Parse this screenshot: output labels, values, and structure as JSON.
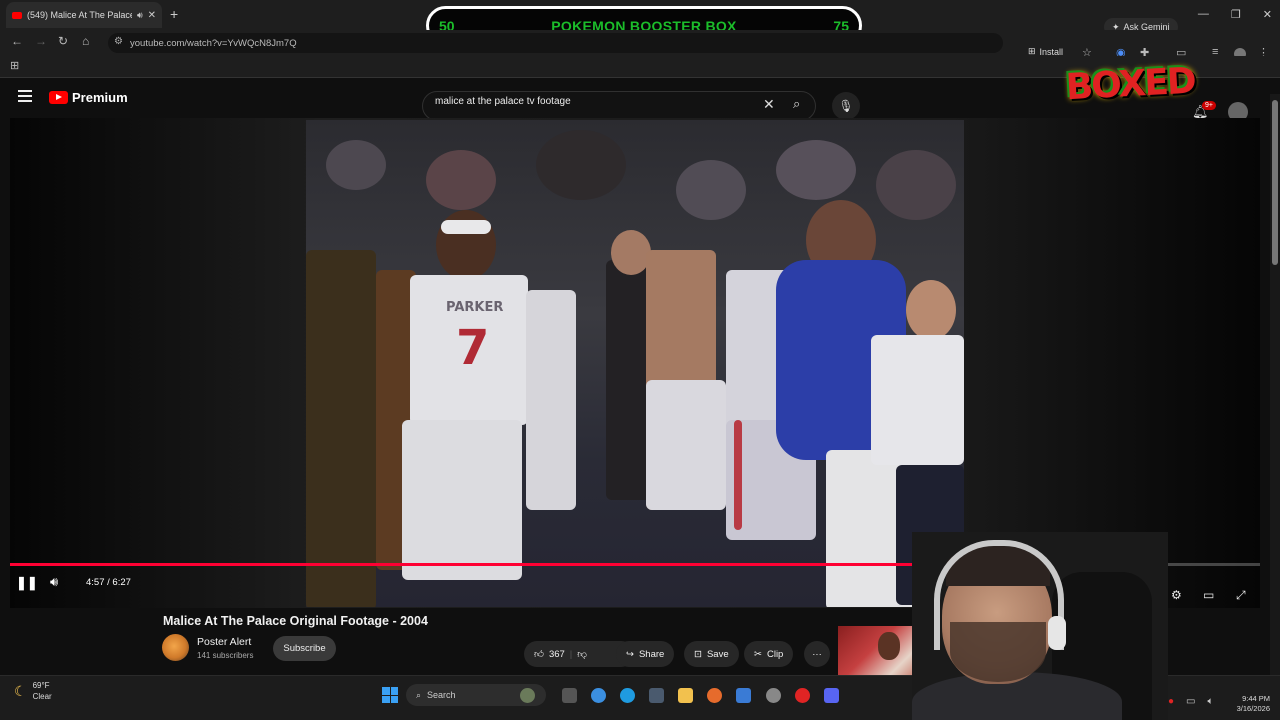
{
  "browser": {
    "tab_title": "(549) Malice At The Palace (",
    "new_tab_icon": "+",
    "url": "youtube.com/watch?v=YvWQcN8Jm7Q",
    "ask_gemini": "Ask Gemini",
    "install_label": "Install"
  },
  "overlay": {
    "left_value": "50",
    "title": "POKEMON BOOSTER BOX",
    "right_value": "75",
    "brand_logo": "BOXED"
  },
  "youtube": {
    "logo_text": "Premium",
    "search_query": "malice at the palace tv footage",
    "notifications_badge": "9+"
  },
  "player": {
    "time_display": "4:57 / 6:27",
    "progress": 0.768,
    "jersey_name": "PARKER",
    "jersey_number": "7"
  },
  "video": {
    "title": "Malice At The Palace Original Footage - 2004",
    "channel_name": "Poster Alert",
    "subscribers": "141 subscribers",
    "subscribe_label": "Subscribe",
    "like_count": "367",
    "share_label": "Share",
    "save_label": "Save",
    "clip_label": "Clip",
    "more_label": "···"
  },
  "taskbar": {
    "temperature": "69°F",
    "weather": "Clear",
    "search_label": "Search",
    "time": "9:44 PM",
    "date": "3/16/2026"
  },
  "colors": {
    "banner_text": "#1bbd2a",
    "progress_red": "#ff0033",
    "youtube_red": "#ff0000"
  }
}
